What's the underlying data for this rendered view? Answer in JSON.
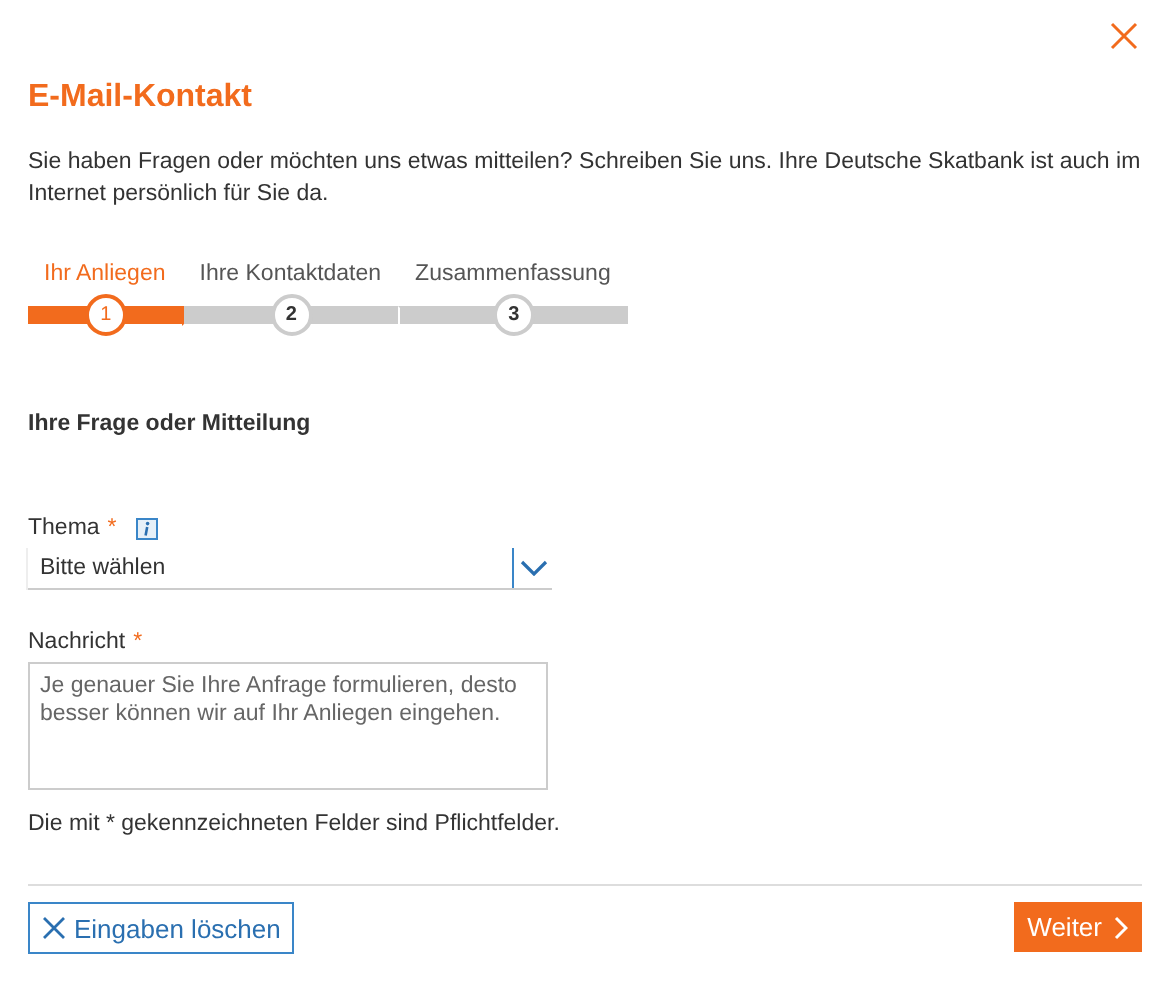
{
  "title": "E-Mail-Kontakt",
  "intro": "Sie haben Fragen oder möchten uns etwas mitteilen? Schreiben Sie uns. Ihre Deutsche Skatbank ist auch im Internet persönlich für Sie da.",
  "steps": [
    {
      "label": "Ihr Anliegen",
      "number": "1",
      "selected": true
    },
    {
      "label": "Ihre Kontaktdaten",
      "number": "2",
      "selected": false
    },
    {
      "label": "Zusammenfassung",
      "number": "3",
      "selected": false
    }
  ],
  "section_heading": "Ihre Frage oder Mitteilung",
  "topic_field": {
    "label": "Thema",
    "required_mark": "*",
    "value": "Bitte wählen"
  },
  "message_field": {
    "label": "Nachricht",
    "required_mark": "*",
    "placeholder": "Je genauer Sie Ihre Anfrage formulieren, desto besser können wir auf Ihr Anliegen eingehen."
  },
  "required_note": "Die mit * gekennzeichneten Felder sind Pflichtfelder.",
  "buttons": {
    "clear": "Eingaben löschen",
    "next": "Weiter"
  }
}
